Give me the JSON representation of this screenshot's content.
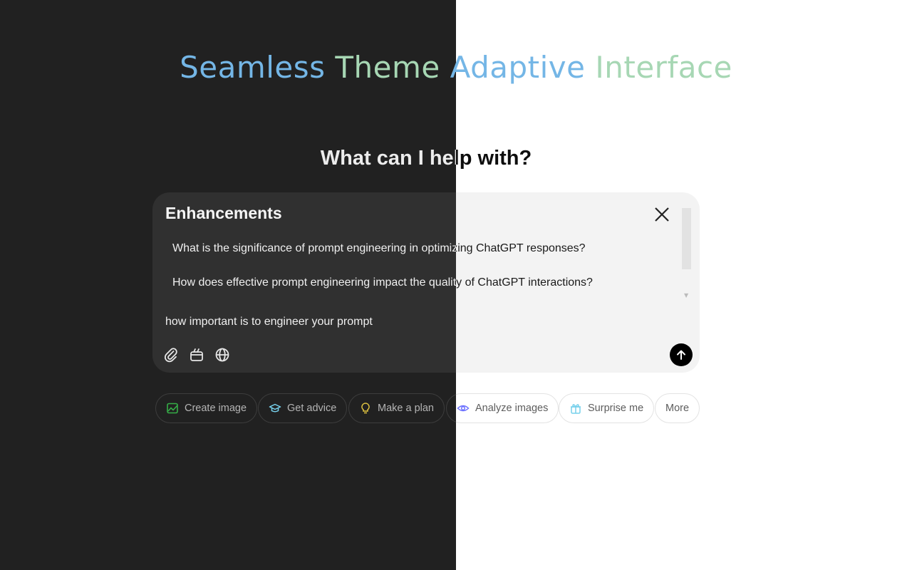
{
  "title": {
    "words": [
      "Seamless",
      "Theme",
      "Adaptive",
      "Interface"
    ]
  },
  "heading": "What can I help with?",
  "enhancements": {
    "title": "Enhancements",
    "suggestions": [
      "What is the significance of prompt engineering in optimizing ChatGPT responses?",
      "How does effective prompt engineering impact the quality of ChatGPT interactions?"
    ]
  },
  "input": {
    "value": "how important is to engineer your prompt"
  },
  "chips": [
    {
      "label": "Create image",
      "icon": "image-icon",
      "color": "#35ae47"
    },
    {
      "label": "Get advice",
      "icon": "graduation-cap-icon",
      "color": "#76d0eb"
    },
    {
      "label": "Make a plan",
      "icon": "lightbulb-icon",
      "color": "#e2c541"
    },
    {
      "label": "Analyze images",
      "icon": "eye-icon",
      "color": "#6c71ff"
    },
    {
      "label": "Surprise me",
      "icon": "gift-icon",
      "color": "#76d0eb"
    },
    {
      "label": "More",
      "icon": "",
      "color": ""
    }
  ],
  "colors": {
    "dark_bg": "#212121",
    "light_bg": "#ffffff",
    "title_blue": "#74b6e6",
    "title_green": "#a7d7b4"
  }
}
